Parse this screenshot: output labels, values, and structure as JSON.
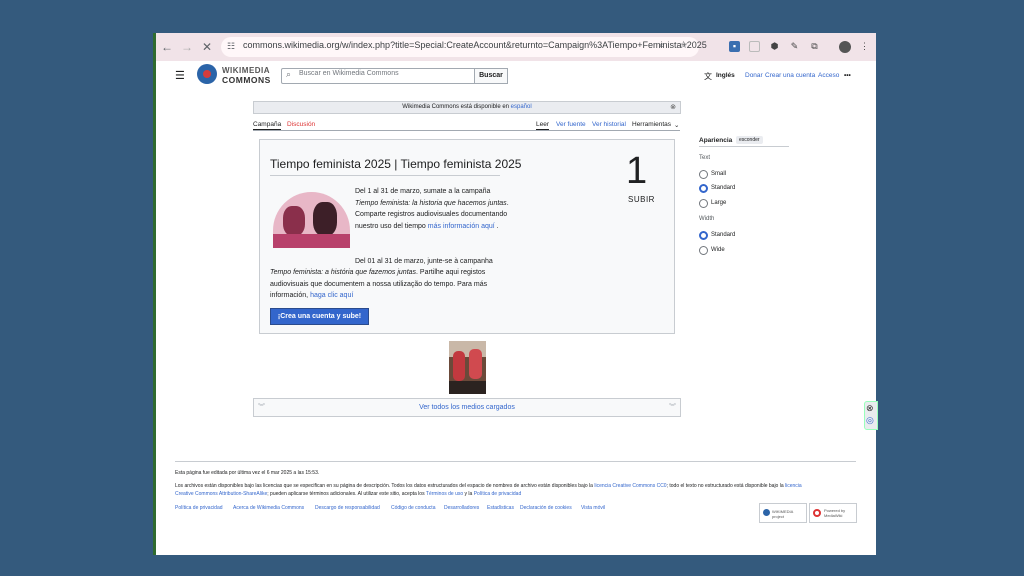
{
  "browser": {
    "url": "commons.wikimedia.org/w/index.php?title=Special:CreateAccount&returnto=Campaign%3ATiempo+Feminista+2025",
    "back_icon": "←",
    "forward_icon": "→",
    "stop_icon": "✕"
  },
  "header": {
    "logo_line1": "WIKIMEDIA",
    "logo_line2": "COMMONS",
    "search_placeholder": "Buscar en Wikimedia Commons",
    "search_button": "Buscar",
    "language": "Inglés",
    "donate": "Donar",
    "create_account": "Crear una cuenta",
    "login": "Acceso",
    "more": "•••"
  },
  "notice": {
    "text": "Wikimedia Commons está disponible en",
    "link": "español"
  },
  "tabs": {
    "campaign": "Campaña",
    "discussion": "Discusión",
    "read": "Leer",
    "view_source": "Ver fuente",
    "view_history": "Ver historial",
    "tools": "Herramientas"
  },
  "campaign": {
    "title": "Tiempo feminista 2025 | Tiempo feminista 2025",
    "count": "1",
    "count_label": "SUBIR",
    "es_p1": "Del 1 al 31 de marzo, sumate a la campaña",
    "es_italic": "Tiempo feminista: la historia que hacemos juntas",
    "es_p2": ". Comparte registros audiovisuales documentando nuestro uso del tiempo",
    "es_link": "más información aquí",
    "pt_p1": "Del 01 al 31 de marzo, junte-se à campanha",
    "pt_italic": "Tempo feminista: a história que fazemos juntas",
    "pt_p2": ". Partilhe aqui registos audiovisuais que documentem a nossa utilização do tempo. Para más información,",
    "pt_link": "haga clic aquí",
    "button": "¡Crea una cuenta y sube!"
  },
  "media": {
    "view_all": "Ver todos los medios cargados"
  },
  "appearance": {
    "title": "Apariencia",
    "hide": "esconder",
    "text_label": "Text",
    "text_options": [
      "Small",
      "Standard",
      "Large"
    ],
    "text_selected": "Standard",
    "width_label": "Width",
    "width_options": [
      "Standard",
      "Wide"
    ],
    "width_selected": "Standard"
  },
  "footer": {
    "edited": "Esta página fue editada por última vez el 6 mar 2025 a las 15:53.",
    "license_1": "Los archivos están disponibles bajo las licencias que se especifican en su página de descripción. Todos los datos estructurados del espacio de nombres de archivo están disponibles bajo la",
    "license_link1": "licencia Creative Commons CC0",
    "license_2": "; todo el texto no estructurado está disponible bajo la",
    "license_link2": "licencia",
    "license_3_link": "Creative Commons Attribution-ShareAlike",
    "license_4": "; pueden aplicarse términos adicionales. Al utilizar este sitio, acepta los",
    "license_link3": "Términos de uso",
    "license_5": "y la",
    "license_link4": "Política de privacidad",
    "links": [
      "Política de privacidad",
      "Acerca de Wikimedia Commons",
      "Descargo de responsabilidad",
      "Código de conducta",
      "Desarrolladores",
      "Estadísticas",
      "Declaración de cookies",
      "Vista móvil"
    ],
    "badge_wikimedia": "WIKIMEDIA project",
    "badge_mediawiki": "Powered by MediaWiki"
  },
  "colors": {
    "link": "#3366cc",
    "page_bg": "#345a7d",
    "button": "#3366cc"
  }
}
